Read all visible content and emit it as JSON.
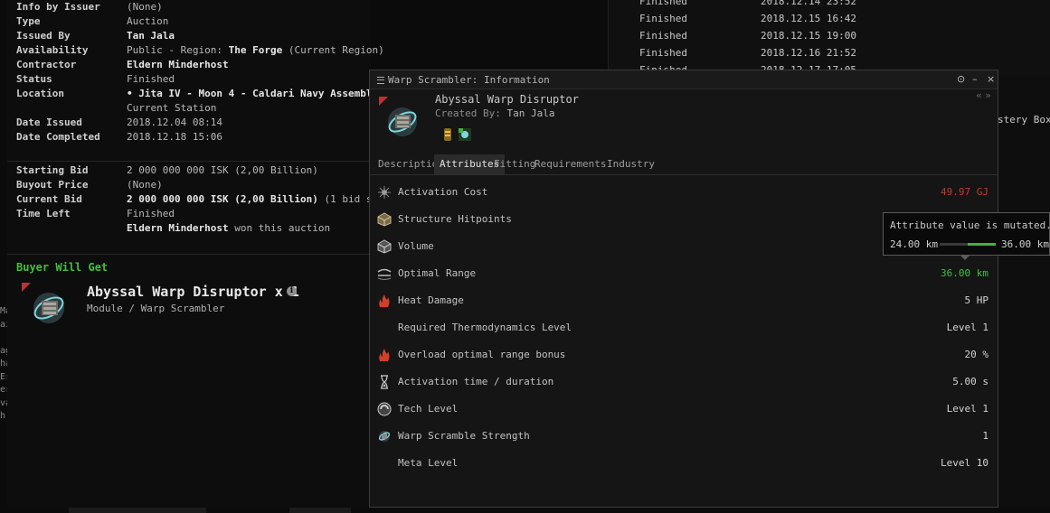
{
  "background_list": {
    "right_rows": [
      {
        "status": "Finished",
        "date": "2018.12.14 23:52"
      },
      {
        "status": "Finished",
        "date": "2018.12.15 16:42"
      },
      {
        "status": "Finished",
        "date": "2018.12.15 19:00"
      },
      {
        "status": "Finished",
        "date": "2018.12.16 21:52"
      },
      {
        "status": "Finished",
        "date": "2018.12.17 17:05"
      }
    ],
    "mystery_text": "stery Box",
    "edge_letters": "Ma\nai\n\nag\nha\nEr\ner\nva\nh"
  },
  "contract": {
    "rows1": [
      {
        "label": "Info by Issuer",
        "value": "(None)"
      },
      {
        "label": "Type",
        "value": "Auction"
      },
      {
        "label": "Issued By",
        "value": "Tan Jala",
        "bold": true
      },
      {
        "label": "Availability",
        "value": "Public - Region: ",
        "bold_suffix": "The Forge",
        "suffix": " (Current Region)"
      },
      {
        "label": "Contractor",
        "value": "Eldern Minderhost",
        "bold": true
      },
      {
        "label": "Status",
        "value": "Finished"
      },
      {
        "label": "Location",
        "value": "• Jita IV - Moon 4 - Caldari Navy Assembly Plant",
        "bold": true
      },
      {
        "label": "",
        "value": "Current Station"
      },
      {
        "label": "Date Issued",
        "value": "2018.12.04 08:14"
      },
      {
        "label": "Date Completed",
        "value": "2018.12.18 15:06"
      }
    ],
    "rows2": [
      {
        "label": "Starting Bid",
        "value": "2 000 000 000 ISK (2,00 Billion)"
      },
      {
        "label": "Buyout Price",
        "value": "(None)"
      },
      {
        "label": "Current Bid",
        "value": "2 000 000 000 ISK (2,00 Billion)",
        "bold": true,
        "suffix": " (1 bid so far)"
      },
      {
        "label": "Time Left",
        "value": "Finished"
      },
      {
        "label": "",
        "value": "Eldern Minderhost",
        "bold": true,
        "suffix": " won this auction"
      }
    ],
    "buyer_title": "Buyer Will Get",
    "item_name": "Abyssal Warp Disruptor x 1",
    "item_sub": "Module / Warp Scrambler",
    "info_glyph": "i"
  },
  "window": {
    "title": "Warp Scrambler: Information",
    "controls": [
      "⊙",
      "–",
      "×"
    ],
    "nav": "« »",
    "item_name": "Abyssal Warp Disruptor",
    "created_by_label": "Created By:",
    "created_by": "Tan Jala",
    "tabs": [
      "Description",
      "Attributes",
      "Fitting",
      "Requirements",
      "Industry"
    ],
    "active_tab": "Attributes",
    "attributes": [
      {
        "name": "Activation Cost",
        "value": "49.97 GJ",
        "color": "#c0392b",
        "icon": "capacitor-icon"
      },
      {
        "name": "Structure Hitpoints",
        "value": "",
        "color": "#d4d4d4",
        "icon": "structure-icon"
      },
      {
        "name": "Volume",
        "value": "",
        "color": "#d4d4d4",
        "icon": "volume-icon"
      },
      {
        "name": "Optimal Range",
        "value": "36.00 km",
        "color": "#3fbf3f",
        "icon": "range-icon"
      },
      {
        "name": "Heat Damage",
        "value": "5 HP",
        "color": "#d4d4d4",
        "icon": "heat-icon"
      },
      {
        "name": "Required Thermodynamics Level",
        "value": "Level 1",
        "color": "#d4d4d4",
        "icon": ""
      },
      {
        "name": "Overload optimal range bonus",
        "value": "20 %",
        "color": "#d4d4d4",
        "icon": "heat-icon"
      },
      {
        "name": "Activation time / duration",
        "value": "5.00 s",
        "color": "#d4d4d4",
        "icon": "hourglass-icon"
      },
      {
        "name": "Tech Level",
        "value": "Level 1",
        "color": "#d4d4d4",
        "icon": "tech-icon"
      },
      {
        "name": "Warp Scramble Strength",
        "value": "1",
        "color": "#d4d4d4",
        "icon": "scrambler-icon"
      },
      {
        "name": "Meta Level",
        "value": "Level 10",
        "color": "#d4d4d4",
        "icon": ""
      }
    ]
  },
  "tooltip": {
    "title": "Attribute value is mutated.",
    "min": "24.00 km",
    "max": "36.00 km",
    "fraction": 0.5
  },
  "colors": {
    "accent_green": "#3fc13f",
    "red_value": "#c0392b"
  }
}
